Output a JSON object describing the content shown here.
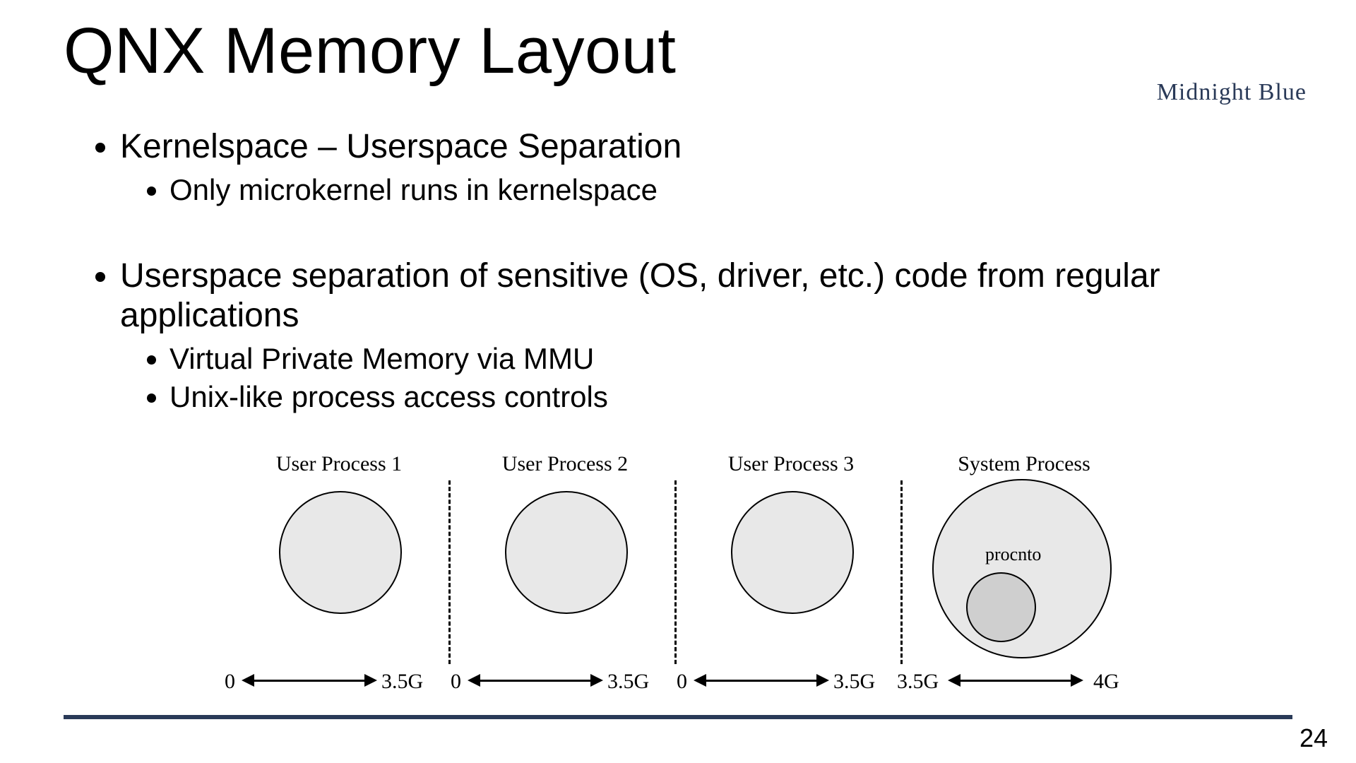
{
  "slide": {
    "title": "QNX Memory Layout",
    "page_number": "24",
    "brand": "Midnight Blue"
  },
  "bullets": {
    "b1": "Kernelspace – Userspace Separation",
    "b1s1": "Only microkernel runs in kernelspace",
    "b2": "Userspace separation of sensitive (OS, driver, etc.) code from regular applications",
    "b2s1": "Virtual Private Memory via MMU",
    "b2s2": "Unix-like process access controls"
  },
  "diagram": {
    "regions": {
      "r1": {
        "label": "User Process 1",
        "axis_left": "0",
        "axis_right": "3.5G"
      },
      "r2": {
        "label": "User Process 2",
        "axis_left": "0",
        "axis_right": "3.5G"
      },
      "r3": {
        "label": "User Process 3",
        "axis_left": "0",
        "axis_right": "3.5G"
      },
      "r4": {
        "label": "System Process",
        "axis_left": "3.5G",
        "axis_right": "4G",
        "inner_label": "procnto"
      }
    }
  }
}
